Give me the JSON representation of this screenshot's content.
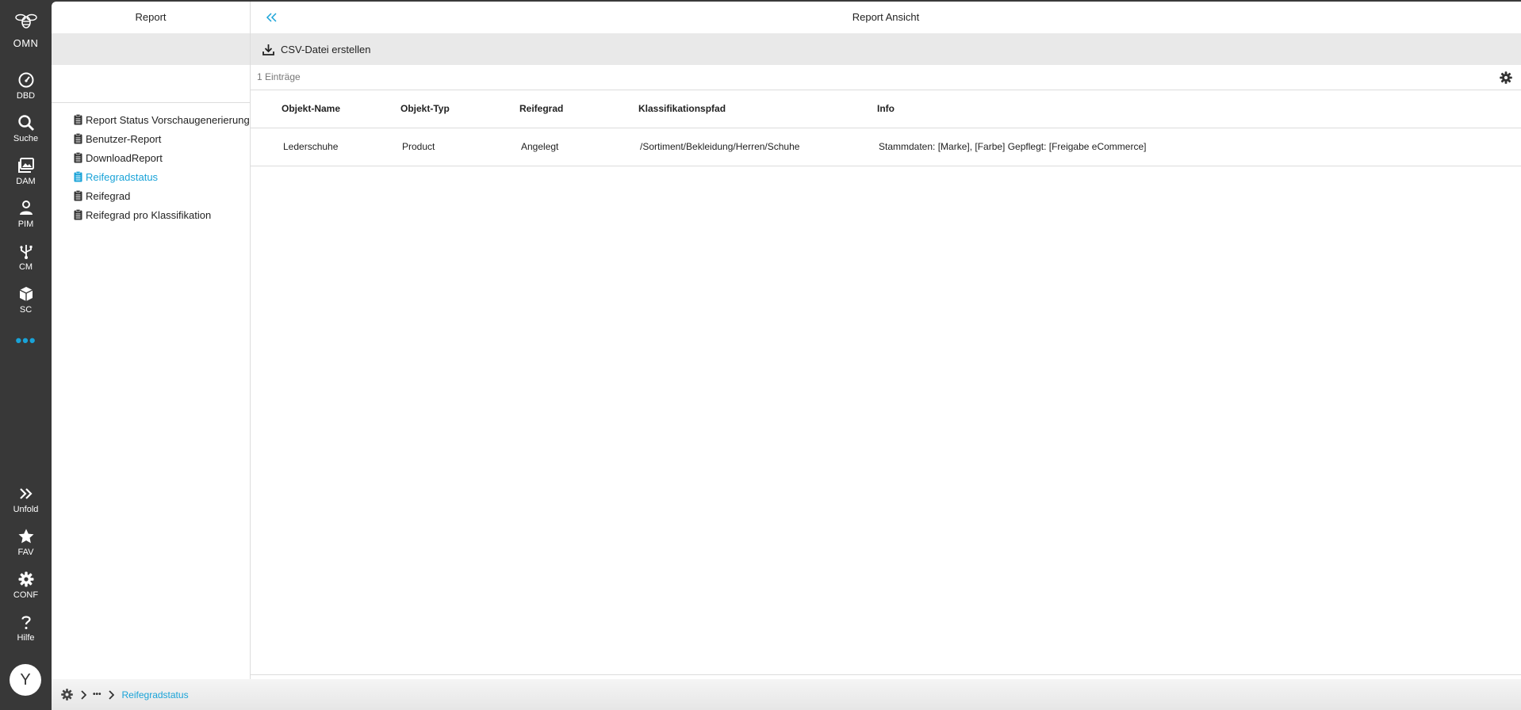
{
  "rail": {
    "logo_text": "OMN",
    "items": [
      {
        "label": "DBD",
        "icon": "gauge-icon"
      },
      {
        "label": "Suche",
        "icon": "search-icon"
      },
      {
        "label": "DAM",
        "icon": "images-icon"
      },
      {
        "label": "PIM",
        "icon": "user-cog-icon"
      },
      {
        "label": "CM",
        "icon": "usb-icon"
      },
      {
        "label": "SC",
        "icon": "cube-icon"
      }
    ],
    "more_label": "•••",
    "bottom_items": [
      {
        "label": "Unfold",
        "icon": "double-chevron-right-icon"
      },
      {
        "label": "FAV",
        "icon": "star-icon"
      },
      {
        "label": "CONF",
        "icon": "gear-icon"
      },
      {
        "label": "Hilfe",
        "icon": "question-icon"
      }
    ],
    "avatar_letter": "Y"
  },
  "tree": {
    "title": "Report",
    "items": [
      {
        "label": "Report Status Vorschaugenerierung",
        "active": false
      },
      {
        "label": "Benutzer-Report",
        "active": false
      },
      {
        "label": "DownloadReport",
        "active": false
      },
      {
        "label": "Reifegradstatus",
        "active": true
      },
      {
        "label": "Reifegrad",
        "active": false
      },
      {
        "label": "Reifegrad pro Klassifikation",
        "active": false
      }
    ]
  },
  "main": {
    "title": "Report Ansicht",
    "csv_button": "CSV-Datei erstellen",
    "count_text": "1 Einträge",
    "columns": [
      "Objekt-Name",
      "Objekt-Typ",
      "Reifegrad",
      "Klassifikationspfad",
      "Info"
    ],
    "rows": [
      [
        "Lederschuhe",
        "Product",
        "Angelegt",
        "/Sortiment/Bekleidung/Herren/Schuhe",
        "Stammdaten: [Marke], [Farbe] Gepflegt: [Freigabe eCommerce]"
      ]
    ]
  },
  "breadcrumb": {
    "ellipsis": "•••",
    "current": "Reifegradstatus"
  },
  "colors": {
    "accent": "#19a3d8",
    "rail_bg": "#383838"
  }
}
